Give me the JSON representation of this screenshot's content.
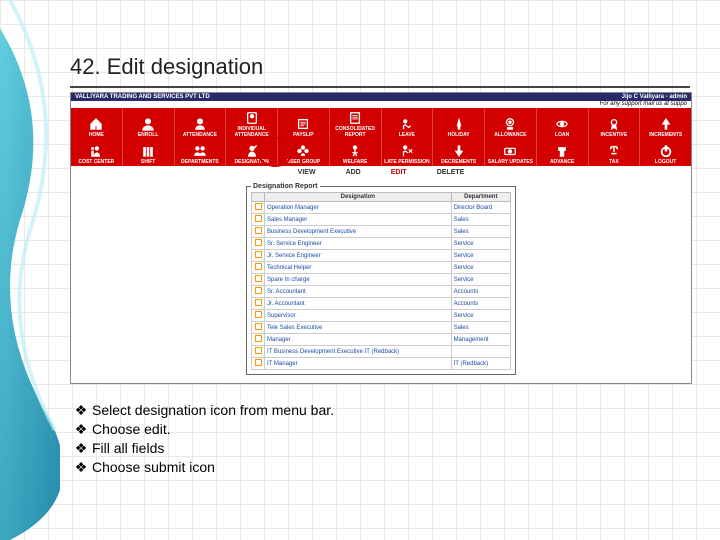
{
  "title": "42. Edit designation",
  "header": {
    "company": "VALLIYARA TRADING AND SERVICES PVT LTD",
    "user": "Jijo C Valliyara - admin",
    "support": "For any support mail us at suppo"
  },
  "menu1": [
    {
      "label": "HOME",
      "icon": "home"
    },
    {
      "label": "ENROLL",
      "icon": "enroll"
    },
    {
      "label": "ATTENDANCE",
      "icon": "attendance"
    },
    {
      "label": "INDIVIDUAL ATTENDANCE",
      "icon": "indiv"
    },
    {
      "label": "PAYSLIP",
      "icon": "payslip"
    },
    {
      "label": "CONSOLIDATED REPORT",
      "icon": "report"
    },
    {
      "label": "LEAVE",
      "icon": "leave"
    },
    {
      "label": "HOLIDAY",
      "icon": "holiday"
    },
    {
      "label": "ALLOWANCE",
      "icon": "allow"
    },
    {
      "label": "LOAN",
      "icon": "loan"
    },
    {
      "label": "INCENTIVE",
      "icon": "incentive"
    },
    {
      "label": "INCREMENTS",
      "icon": "incr"
    }
  ],
  "menu2": [
    {
      "label": "COST CENTER",
      "icon": "cc"
    },
    {
      "label": "SHIFT",
      "icon": "shift"
    },
    {
      "label": "DEPARTMENTS",
      "icon": "dept"
    },
    {
      "label": "DESIGNATION",
      "icon": "desig"
    },
    {
      "label": "USER GROUP",
      "icon": "ugroup"
    },
    {
      "label": "WELFARE",
      "icon": "welfare"
    },
    {
      "label": "LATE PERMISSION",
      "icon": "late"
    },
    {
      "label": "DECREMENTS",
      "icon": "decr"
    },
    {
      "label": "SALARY UPDATES",
      "icon": "salup"
    },
    {
      "label": "ADVANCE",
      "icon": "adv"
    },
    {
      "label": "TAX",
      "icon": "tax"
    },
    {
      "label": "LOGOUT",
      "icon": "logout"
    }
  ],
  "tabs": {
    "view": "VIEW",
    "add": "ADD",
    "edit": "EDIT",
    "delete": "DELETE"
  },
  "panel": {
    "title": "Designation Report",
    "col1": "Designation",
    "col2": "Department",
    "rows": [
      {
        "d": "Operation Manager",
        "p": "Director Board"
      },
      {
        "d": "Sales Manager",
        "p": "Sales"
      },
      {
        "d": "Business Development Executive",
        "p": "Sales"
      },
      {
        "d": "Sr. Service Engineer",
        "p": "Service"
      },
      {
        "d": "Jr. Service Engineer",
        "p": "Service"
      },
      {
        "d": "Technical Helper",
        "p": "Service"
      },
      {
        "d": "Spare In charge",
        "p": "Service"
      },
      {
        "d": "Sr. Accountant",
        "p": "Accounts"
      },
      {
        "d": "Jr. Accountant",
        "p": "Accounts"
      },
      {
        "d": "Supervisor",
        "p": "Service"
      },
      {
        "d": "Tele Sales Executive",
        "p": "Sales"
      },
      {
        "d": "Manager",
        "p": "Management"
      },
      {
        "d": "IT Business Development Executive IT (Redback)",
        "p": ""
      },
      {
        "d": "IT Manager",
        "p": "IT (Redback)"
      }
    ]
  },
  "steps": [
    "Select designation icon from menu bar.",
    "Choose edit.",
    "Fill all fields",
    "Choose submit icon"
  ]
}
